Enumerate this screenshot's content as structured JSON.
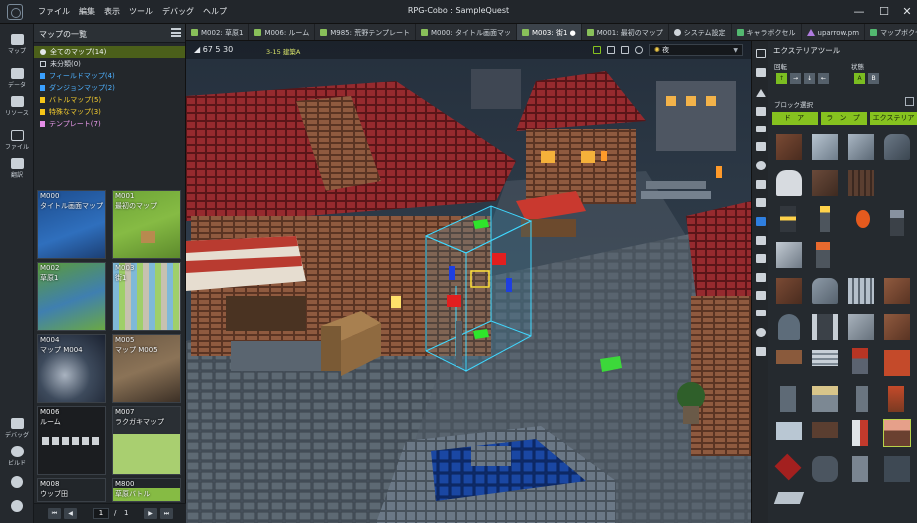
{
  "app": {
    "title": "RPG-Cobo : SampleQuest",
    "menu": [
      "ファイル",
      "編集",
      "表示",
      "ツール",
      "デバッグ",
      "ヘルプ"
    ]
  },
  "rail": [
    {
      "label": "マップ",
      "icon": "map-icon"
    },
    {
      "label": "データ",
      "icon": "database-icon"
    },
    {
      "label": "リソース",
      "icon": "resource-icon"
    },
    {
      "label": "ファイル",
      "icon": "folder-icon"
    },
    {
      "label": "翻訳",
      "icon": "translate-icon"
    },
    {
      "label": "デバッグ",
      "icon": "debug-icon"
    },
    {
      "label": "ビルド",
      "icon": "build-icon"
    },
    {
      "label": "",
      "icon": "account-icon"
    },
    {
      "label": "",
      "icon": "settings-icon"
    }
  ],
  "maplist": {
    "title": "マップの一覧",
    "tree": [
      {
        "label": "全てのマップ(14)",
        "color": "#e3e7ea",
        "kind": "circle"
      },
      {
        "label": "未分類(0)",
        "color": "#c8cfd6",
        "kind": "box"
      },
      {
        "label": "フィールドマップ(4)",
        "color": "#3aa0ff",
        "kind": "bookmark"
      },
      {
        "label": "ダンジョンマップ(2)",
        "color": "#3aa0ff",
        "kind": "bookmark"
      },
      {
        "label": "バトルマップ(5)",
        "color": "#f5c518",
        "kind": "bookmark"
      },
      {
        "label": "特殊なマップ(3)",
        "color": "#f5c518",
        "kind": "bookmark"
      },
      {
        "label": "テンプレート(7)",
        "color": "#e58ee8",
        "kind": "bookmark"
      }
    ],
    "maps": [
      {
        "id": "M000",
        "name": "タイトル画面マップ"
      },
      {
        "id": "M001",
        "name": "最初のマップ"
      },
      {
        "id": "M002",
        "name": "草原1"
      },
      {
        "id": "M003",
        "name": "街1"
      },
      {
        "id": "M004",
        "name": "マップ M004"
      },
      {
        "id": "M005",
        "name": "マップ M005"
      },
      {
        "id": "M006",
        "name": "ルーム"
      },
      {
        "id": "M007",
        "name": "ラクガキマップ"
      },
      {
        "id": "M008",
        "name": "ウッブ田"
      },
      {
        "id": "M800",
        "name": "草原バトル"
      }
    ],
    "pager": {
      "first": "⏮",
      "prev": "◀",
      "current": "1",
      "sep": "/",
      "total": "1",
      "next": "▶",
      "last": "⏭"
    }
  },
  "tabs": [
    {
      "label": "M002: 草原1",
      "icon": "map"
    },
    {
      "label": "M006: ルーム",
      "icon": "map"
    },
    {
      "label": "M985: 荒野テンプレート",
      "icon": "map"
    },
    {
      "label": "M000: タイトル画面マッ",
      "icon": "map"
    },
    {
      "label": "M003: 街1 ●",
      "icon": "map",
      "active": true
    },
    {
      "label": "M001: 最初のマップ",
      "icon": "map"
    },
    {
      "label": "システム設定",
      "icon": "gear"
    },
    {
      "label": "キャラボクセル",
      "icon": "vox"
    },
    {
      "label": "uparrow.pm",
      "icon": "tri"
    },
    {
      "label": "マップボクセル",
      "icon": "vox"
    }
  ],
  "viewport": {
    "coord": "◢ 67  5  30",
    "selection_label": "3-15 建築A",
    "time_of_day": "夜"
  },
  "ext": {
    "title": "エクステリアツール",
    "rotation_label": "回転",
    "state_label": "状態",
    "rotate_buttons": [
      "↑",
      "→",
      "↓",
      "←"
    ],
    "state_buttons": [
      "A",
      "B"
    ],
    "block_select_label": "ブロック選択",
    "categories": [
      "ド ア",
      "ラ ン プ",
      "エクステリア"
    ]
  },
  "colors": {
    "accent": "#86c21f",
    "selection_box": "#3fd8ff",
    "tree_selected": "#4b5f1a"
  }
}
